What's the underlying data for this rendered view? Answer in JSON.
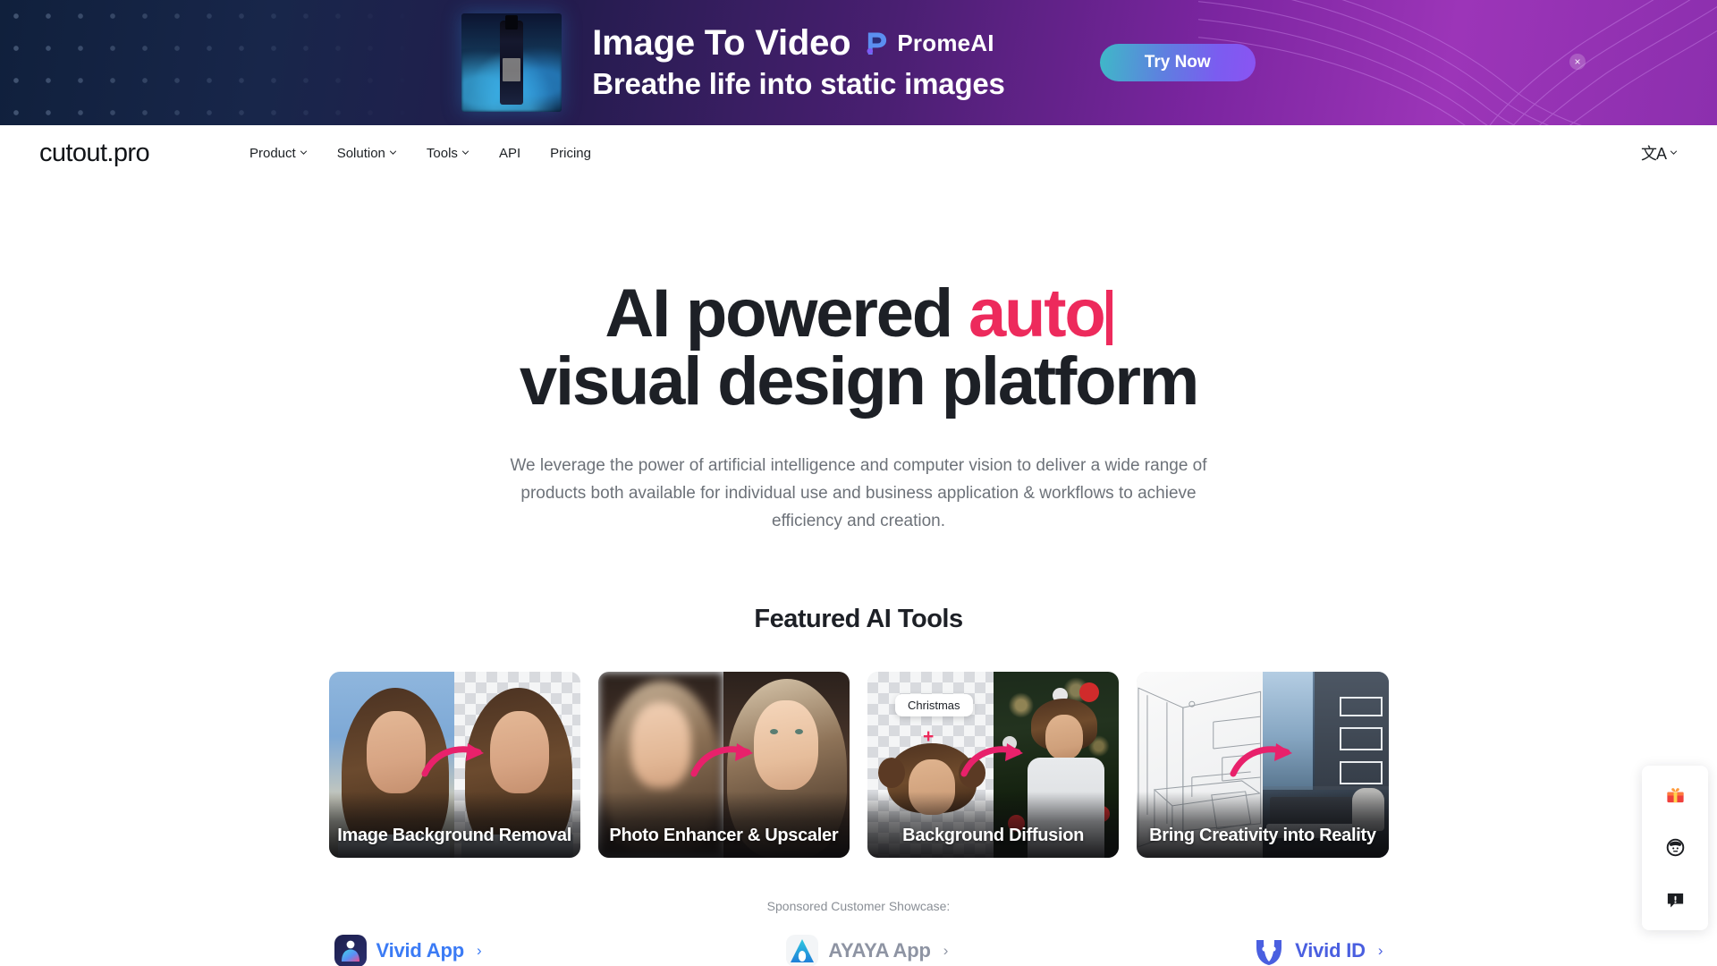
{
  "ad_banner": {
    "headline": "Image To Video",
    "subline": "Breathe life into static images",
    "brand": "PromeAI",
    "cta": "Try Now",
    "close": "×",
    "thumb_alt": "perfume-bottle-thumbnail",
    "colors": {
      "start": "#10203c",
      "end": "#9c35b8",
      "cta_start": "#3fb8c8",
      "cta_end": "#8a54f2"
    }
  },
  "nav": {
    "logo": "cutout.pro",
    "links": [
      {
        "label": "Product",
        "has_caret": true
      },
      {
        "label": "Solution",
        "has_caret": true
      },
      {
        "label": "Tools",
        "has_caret": true
      },
      {
        "label": "API",
        "has_caret": false
      },
      {
        "label": "Pricing",
        "has_caret": false
      }
    ],
    "language": {
      "icon": "文A",
      "caret": true
    }
  },
  "hero": {
    "title_part1": "AI powered ",
    "title_accent": "auto",
    "title_line2": "visual design platform",
    "accent_color": "#ed2a5c",
    "paragraph": "We leverage the power of artificial intelligence and computer vision to deliver a wide range of products both available for individual use and business application & workflows to achieve efficiency and creation."
  },
  "featured": {
    "title": "Featured AI Tools",
    "cards": [
      {
        "label": "Image Background Removal",
        "badge": null,
        "plus": null
      },
      {
        "label": "Photo Enhancer & Upscaler",
        "badge": null,
        "plus": null
      },
      {
        "label": "Background Diffusion",
        "badge": "Christmas",
        "plus": "+"
      },
      {
        "label": "Bring Creativity into Reality",
        "badge": null,
        "plus": null
      }
    ]
  },
  "showcase": {
    "caption": "Sponsored Customer Showcase:",
    "partners": [
      {
        "name": "Vivid App",
        "arrow": "›",
        "color": "#3b7bf5",
        "icon": "vivid-app-icon"
      },
      {
        "name": "AYAYA App",
        "arrow": "›",
        "color": "#8e94a3",
        "icon": "ayaya-app-icon"
      },
      {
        "name": "Vivid ID",
        "arrow": "›",
        "color": "#4a5fe0",
        "icon": "vivid-id-icon"
      }
    ]
  },
  "float_bar": {
    "buttons": [
      {
        "name": "gift-icon",
        "glyph": "🎁"
      },
      {
        "name": "avatar-icon",
        "glyph": ""
      },
      {
        "name": "feedback-icon",
        "glyph": ""
      }
    ]
  }
}
